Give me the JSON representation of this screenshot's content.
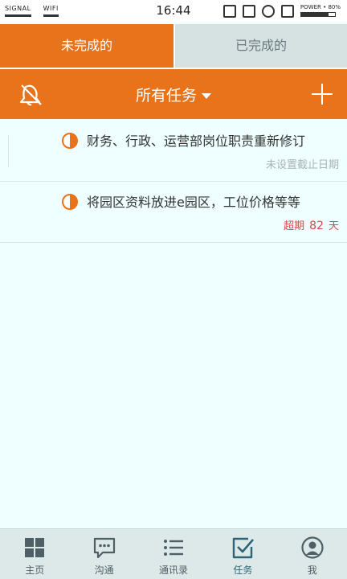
{
  "status_bar": {
    "signal_label": "SIGNAL",
    "wifi_label": "WIFI",
    "time": "16:44",
    "power_label": "POWER • 80%",
    "battery_percent": 80
  },
  "tabs": [
    {
      "label": "未完成的",
      "active": true
    },
    {
      "label": "已完成的",
      "active": false
    }
  ],
  "header": {
    "title": "所有任务",
    "left_icon": "bell-icon",
    "right_icon": "plus-icon"
  },
  "tasks": [
    {
      "title": "财务、行政、运营部岗位职责重新修订",
      "status_icon": "half-circle-icon",
      "meta": "未设置截止日期"
    },
    {
      "title": "将园区资料放进e园区，工位价格等等",
      "status_icon": "half-circle-icon",
      "overdue_prefix": "超期",
      "overdue_days": "82",
      "overdue_suffix": "天"
    }
  ],
  "bottom_nav": [
    {
      "label": "主页",
      "icon": "grid-icon",
      "active": false
    },
    {
      "label": "沟通",
      "icon": "chat-icon",
      "active": false
    },
    {
      "label": "通讯录",
      "icon": "list-icon",
      "active": false
    },
    {
      "label": "任务",
      "icon": "task-check-icon",
      "active": true
    },
    {
      "label": "我",
      "icon": "user-icon",
      "active": false
    }
  ],
  "colors": {
    "accent": "#e8731a",
    "background": "#effefe",
    "overdue": "#d24a4a",
    "muted": "#aab3b5"
  }
}
